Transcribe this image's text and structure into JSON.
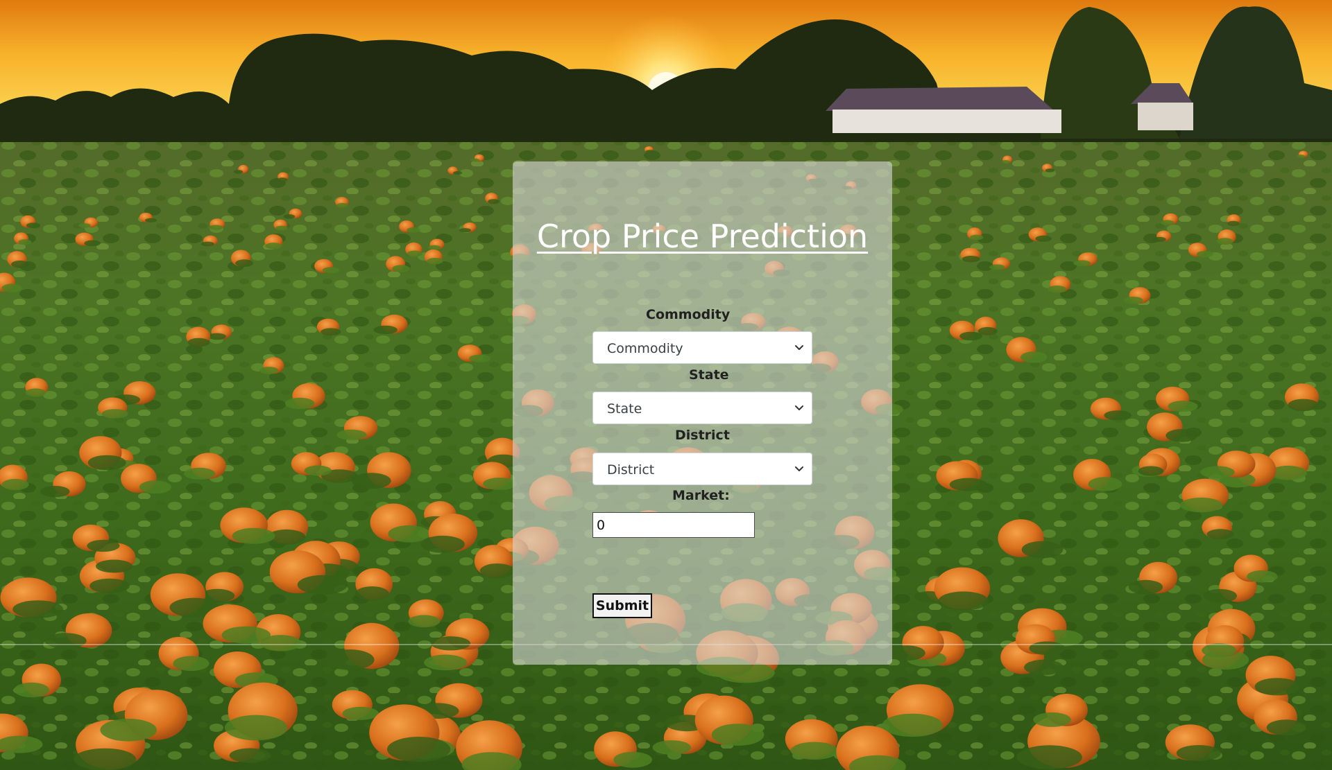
{
  "colors": {
    "sky_top": "#e88a12",
    "sun": "#fff4a8",
    "field_green": "#3f6b1f",
    "pumpkin": "#d9731e",
    "card_overlay": "#d6d6d6",
    "title_color": "#ffffff"
  },
  "form": {
    "title": "Crop Price Prediction",
    "commodity": {
      "label": "Commodity",
      "selected": "Commodity"
    },
    "state": {
      "label": "State",
      "selected": "State"
    },
    "district": {
      "label": "District",
      "selected": "District"
    },
    "market": {
      "label": "Market:",
      "value": "0"
    },
    "submit_label": "Submit"
  },
  "icons": {
    "dropdown": "chevron-down-icon"
  }
}
